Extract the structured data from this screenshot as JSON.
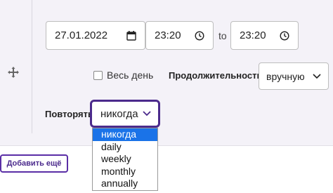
{
  "date": {
    "value": "27.01.2022"
  },
  "time": {
    "from": "23:20",
    "to_label": "to",
    "to": "23:20"
  },
  "all_day": {
    "label": "Весь день",
    "checked": false
  },
  "duration": {
    "label": "Продолжительность",
    "selected": "вручную"
  },
  "repeat": {
    "label": "Повторять",
    "selected": "никогда",
    "options": [
      "никогда",
      "daily",
      "weekly",
      "monthly",
      "annually"
    ],
    "highlighted_index": 0
  },
  "add_more": {
    "label": "Добавить ещё"
  },
  "colors": {
    "accent": "#4b2a8c",
    "highlight": "#1a73e8",
    "panel_bg": "#f4f2f8"
  },
  "icons": {
    "move": "move-arrows-icon",
    "calendar": "calendar-icon",
    "clock": "clock-icon",
    "chevron": "chevron-down-icon"
  }
}
